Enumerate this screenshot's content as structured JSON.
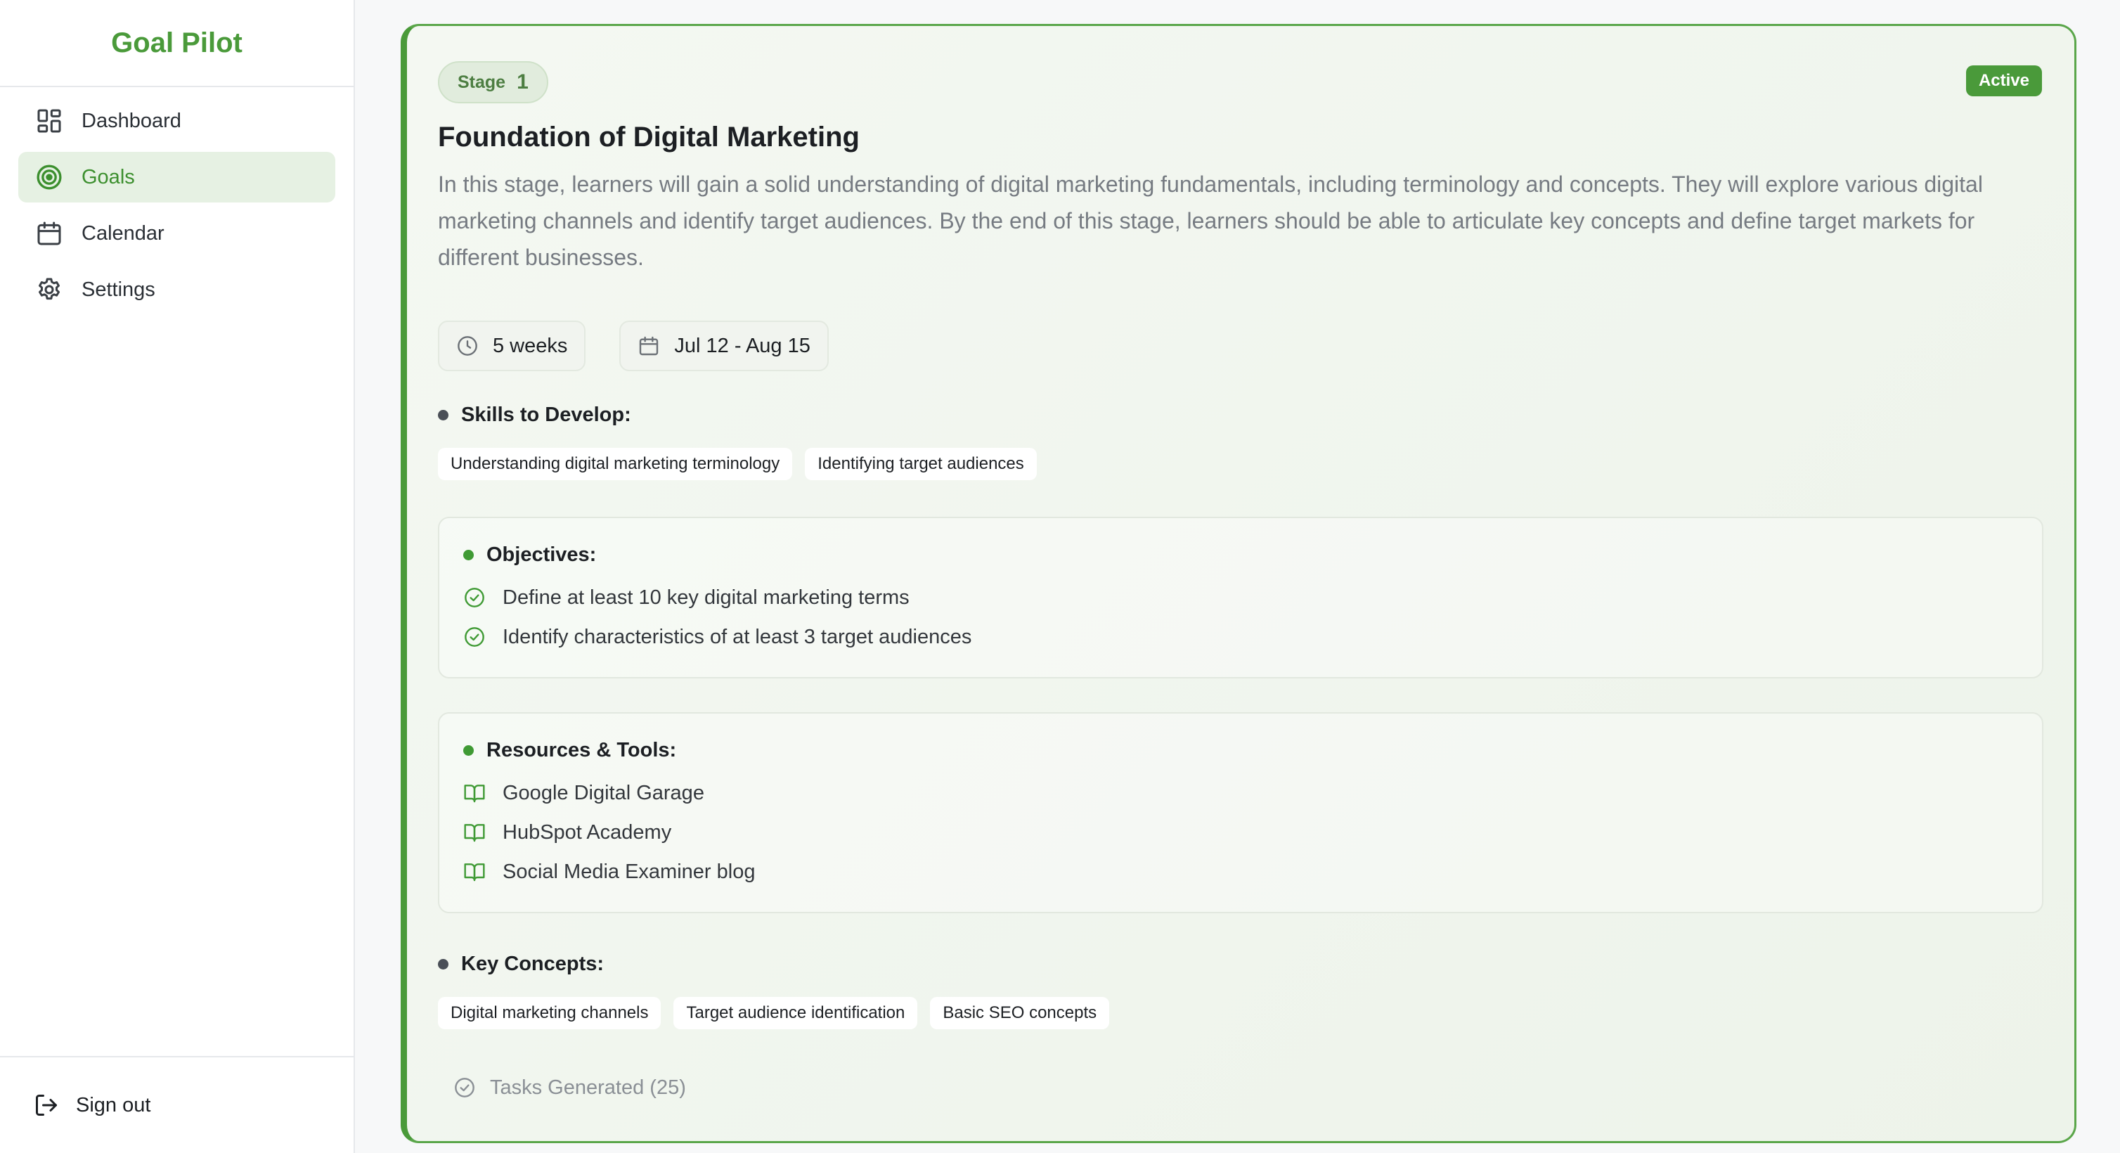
{
  "brand": {
    "name": "Goal Pilot"
  },
  "nav": {
    "items": [
      {
        "label": "Dashboard",
        "icon": "dashboard-icon",
        "active": false
      },
      {
        "label": "Goals",
        "icon": "target-icon",
        "active": true
      },
      {
        "label": "Calendar",
        "icon": "calendar-icon",
        "active": false
      },
      {
        "label": "Settings",
        "icon": "gear-icon",
        "active": false
      }
    ],
    "sign_out": "Sign out"
  },
  "stage": {
    "label": "Stage",
    "number": "1",
    "status": "Active",
    "title": "Foundation of Digital Marketing",
    "description": "In this stage, learners will gain a solid understanding of digital marketing fundamentals, including terminology and concepts. They will explore various digital marketing channels and identify target audiences. By the end of this stage, learners should be able to articulate key concepts and define target markets for different businesses.",
    "duration": "5 weeks",
    "date_range": "Jul 12 - Aug 15",
    "skills": {
      "heading": "Skills to Develop:",
      "items": [
        "Understanding digital marketing terminology",
        "Identifying target audiences"
      ]
    },
    "objectives": {
      "heading": "Objectives:",
      "items": [
        "Define at least 10 key digital marketing terms",
        "Identify characteristics of at least 3 target audiences"
      ]
    },
    "resources": {
      "heading": "Resources & Tools:",
      "items": [
        "Google Digital Garage",
        "HubSpot Academy",
        "Social Media Examiner blog"
      ]
    },
    "concepts": {
      "heading": "Key Concepts:",
      "items": [
        "Digital marketing channels",
        "Target audience identification",
        "Basic SEO concepts"
      ]
    },
    "tasks_label": "Tasks Generated (25)"
  },
  "colors": {
    "brand_green": "#4a9a3a",
    "active_nav_bg": "#e6f1e3",
    "card_border": "#5aa64a",
    "muted_text": "#767b82"
  }
}
